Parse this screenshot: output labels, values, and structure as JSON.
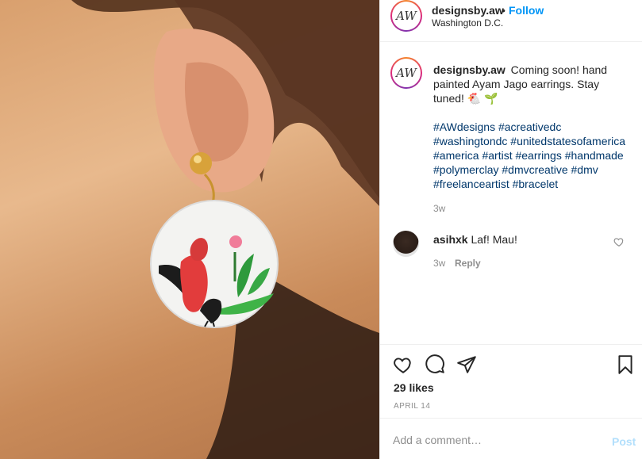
{
  "post": {
    "username": "designsby.aw",
    "follow_label": "Follow",
    "separator": "•",
    "location": "Washington D.C.",
    "avatar_text": "AW"
  },
  "caption": {
    "username": "designsby.aw",
    "text": "Coming soon! hand painted Ayam Jago earrings. Stay tuned! 🐔 🌱",
    "hashtags": "#AWdesigns #acreativedc #washingtondc #unitedstatesofamerica #america #artist #earrings #handmade #polymerclay #dmvcreative #dmv #freelanceartist #bracelet",
    "time": "3w"
  },
  "comments": [
    {
      "username": "asihxk",
      "text": "Laf! Mau!",
      "time": "3w",
      "reply_label": "Reply"
    }
  ],
  "actions": {
    "likes": "29 likes",
    "date": "APRIL 14"
  },
  "add_comment": {
    "placeholder": "Add a comment…",
    "post_label": "Post"
  },
  "colors": {
    "link": "#0095f6",
    "hashtag": "#00376b",
    "muted": "#8e8e8e"
  }
}
